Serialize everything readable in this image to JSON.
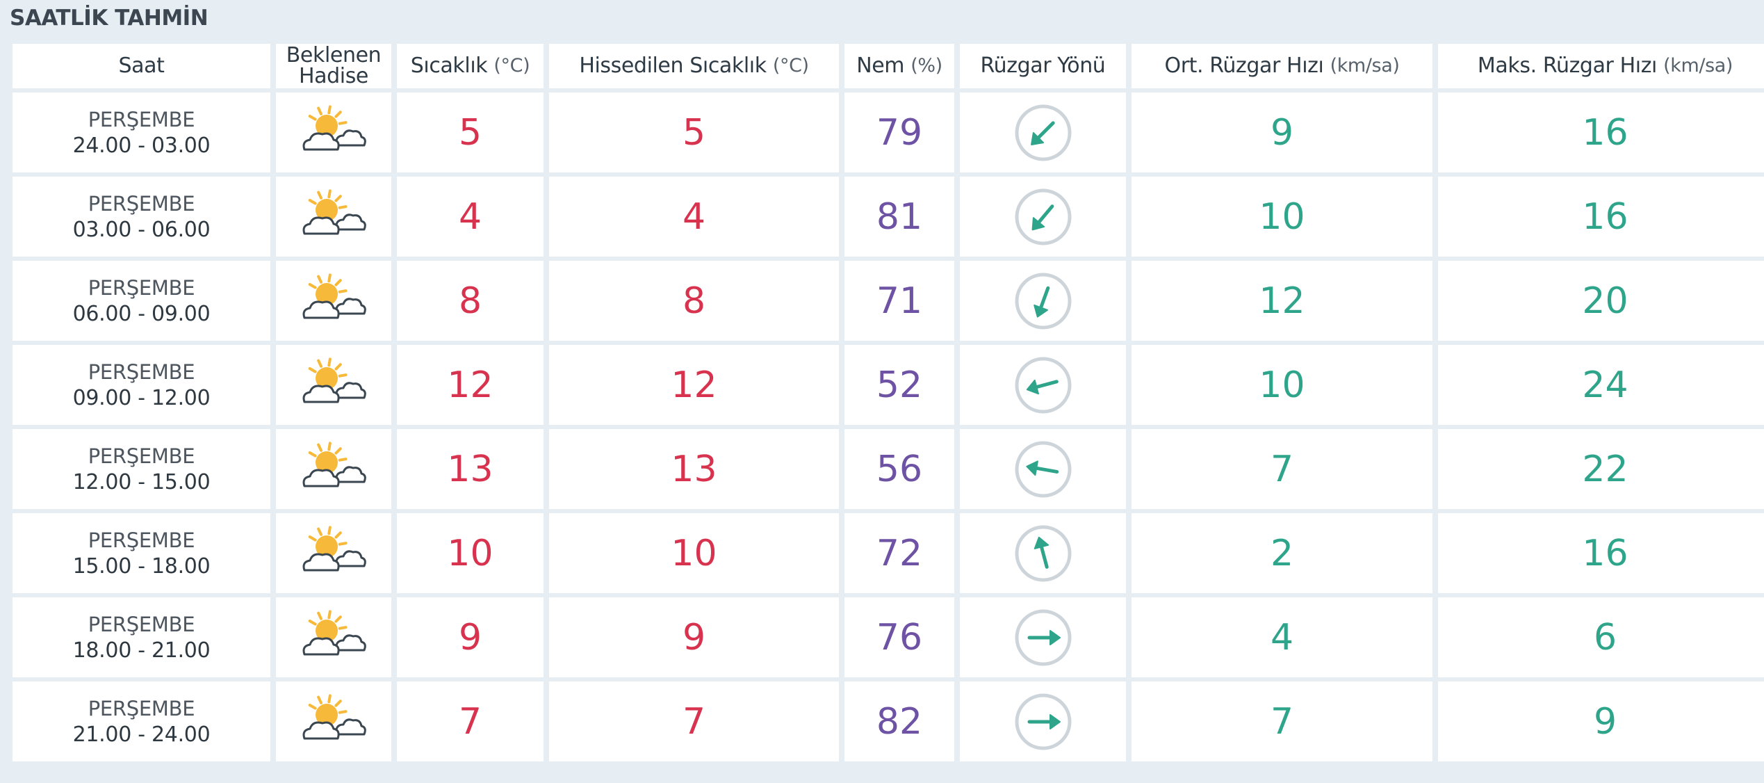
{
  "title": "SAATLİK TAHMİN",
  "headers": {
    "saat": "Saat",
    "hadise_line1": "Beklenen",
    "hadise_line2": "Hadise",
    "sicaklik": "Sıcaklık",
    "sicaklik_unit": "(°C)",
    "hissedilen": "Hissedilen Sıcaklık",
    "hissedilen_unit": "(°C)",
    "nem": "Nem",
    "nem_unit": "(%)",
    "ruzgar_yonu": "Rüzgar Yönü",
    "ort_ruzgar": "Ort. Rüzgar Hızı",
    "ort_ruzgar_unit": "(km/sa)",
    "maks_ruzgar": "Maks. Rüzgar Hızı",
    "maks_ruzgar_unit": "(km/sa)"
  },
  "colors": {
    "temperature": "#d8334e",
    "humidity": "#6e52a4",
    "wind": "#2ea58a",
    "sun": "#f6b93a",
    "cloud_stroke": "#3a4650",
    "compass_ring": "#cdd5db"
  },
  "rows": [
    {
      "day": "PERŞEMBE",
      "range": "24.00 - 03.00",
      "icon": "partly-cloudy-icon",
      "temp": "5",
      "feels": "5",
      "humidity": "79",
      "wind_dir_deg": 45,
      "wind_avg": "9",
      "wind_max": "16"
    },
    {
      "day": "PERŞEMBE",
      "range": "03.00 - 06.00",
      "icon": "partly-cloudy-icon",
      "temp": "4",
      "feels": "4",
      "humidity": "81",
      "wind_dir_deg": 40,
      "wind_avg": "10",
      "wind_max": "16"
    },
    {
      "day": "PERŞEMBE",
      "range": "06.00 - 09.00",
      "icon": "partly-cloudy-icon",
      "temp": "8",
      "feels": "8",
      "humidity": "71",
      "wind_dir_deg": 20,
      "wind_avg": "12",
      "wind_max": "20"
    },
    {
      "day": "PERŞEMBE",
      "range": "09.00 - 12.00",
      "icon": "partly-cloudy-icon",
      "temp": "12",
      "feels": "12",
      "humidity": "52",
      "wind_dir_deg": 75,
      "wind_avg": "10",
      "wind_max": "24"
    },
    {
      "day": "PERŞEMBE",
      "range": "12.00 - 15.00",
      "icon": "partly-cloudy-icon",
      "temp": "13",
      "feels": "13",
      "humidity": "56",
      "wind_dir_deg": 100,
      "wind_avg": "7",
      "wind_max": "22"
    },
    {
      "day": "PERŞEMBE",
      "range": "15.00 - 18.00",
      "icon": "partly-cloudy-icon",
      "temp": "10",
      "feels": "10",
      "humidity": "72",
      "wind_dir_deg": 165,
      "wind_avg": "2",
      "wind_max": "16"
    },
    {
      "day": "PERŞEMBE",
      "range": "18.00 - 21.00",
      "icon": "partly-cloudy-icon",
      "temp": "9",
      "feels": "9",
      "humidity": "76",
      "wind_dir_deg": 270,
      "wind_avg": "4",
      "wind_max": "6"
    },
    {
      "day": "PERŞEMBE",
      "range": "21.00 - 24.00",
      "icon": "partly-cloudy-icon",
      "temp": "7",
      "feels": "7",
      "humidity": "82",
      "wind_dir_deg": 270,
      "wind_avg": "7",
      "wind_max": "9"
    }
  ]
}
